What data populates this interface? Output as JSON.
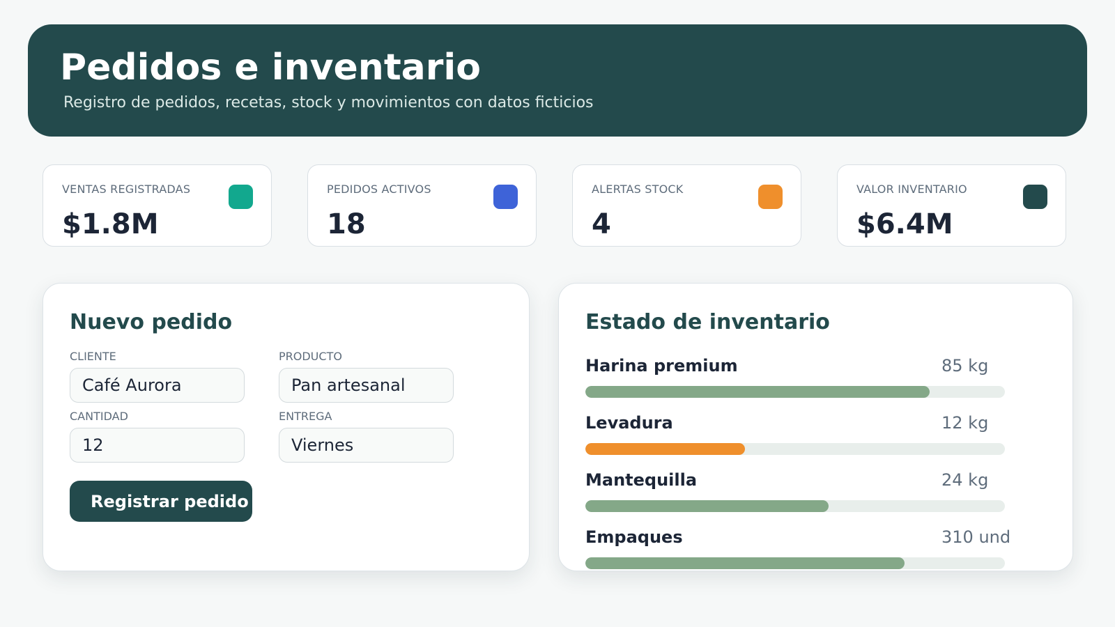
{
  "header": {
    "title": "Pedidos e inventario",
    "subtitle": "Registro de pedidos, recetas, stock y movimientos con datos ficticios"
  },
  "kpis": [
    {
      "label": "VENTAS REGISTRADAS",
      "value": "$1.8M",
      "color": "#12a88e"
    },
    {
      "label": "PEDIDOS ACTIVOS",
      "value": "18",
      "color": "#3e63d8"
    },
    {
      "label": "ALERTAS STOCK",
      "value": "4",
      "color": "#ef8f2c"
    },
    {
      "label": "VALOR INVENTARIO",
      "value": "$6.4M",
      "color": "#234a4c"
    }
  ],
  "order_form": {
    "title": "Nuevo pedido",
    "fields": {
      "cliente": {
        "label": "CLIENTE",
        "value": "Café Aurora"
      },
      "producto": {
        "label": "PRODUCTO",
        "value": "Pan artesanal"
      },
      "cantidad": {
        "label": "CANTIDAD",
        "value": "12"
      },
      "entrega": {
        "label": "ENTREGA",
        "value": "Viernes"
      }
    },
    "submit_label": "Registrar pedido"
  },
  "inventory": {
    "title": "Estado de inventario",
    "items": [
      {
        "name": "Harina premium",
        "quantity": "85 kg",
        "level": 0.82,
        "color": "#84a888"
      },
      {
        "name": "Levadura",
        "quantity": "12 kg",
        "level": 0.38,
        "color": "#ef8f2c"
      },
      {
        "name": "Mantequilla",
        "quantity": "24 kg",
        "level": 0.58,
        "color": "#84a888"
      },
      {
        "name": "Empaques",
        "quantity": "310 und",
        "level": 0.76,
        "color": "#84a888"
      }
    ]
  }
}
